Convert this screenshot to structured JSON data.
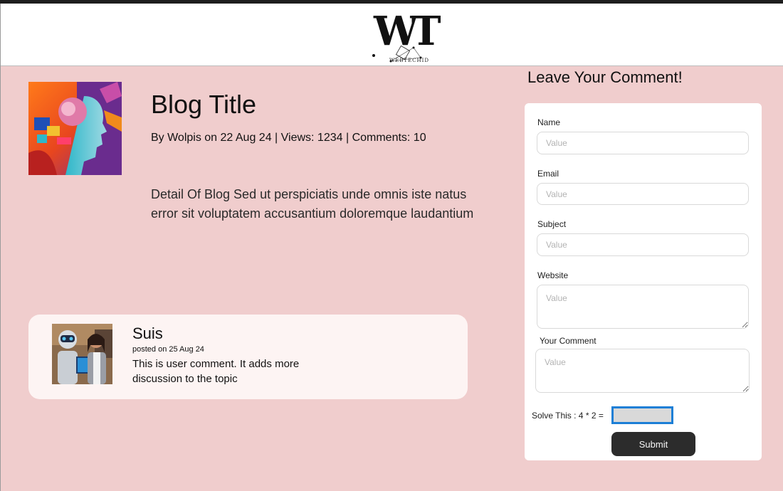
{
  "header": {
    "logo_letters": "WT",
    "logo_subtext": "WEBTECHID"
  },
  "post": {
    "title": "Blog Title",
    "meta": "By Wolpis on 22 Aug 24 | Views: 1234 | Comments: 10",
    "detail": "Detail Of Blog Sed ut perspiciatis unde omnis iste natus error sit voluptatem accusantium doloremque laudantium"
  },
  "comment": {
    "name": "Suis",
    "date": "posted on 25 Aug 24",
    "text": "This is user comment. It adds more discussion to the topic"
  },
  "form": {
    "title": "Leave Your Comment!",
    "name_label": "Name",
    "name_placeholder": "Value",
    "email_label": "Email",
    "email_placeholder": "Value",
    "subject_label": "Subject",
    "subject_placeholder": "Value",
    "website_label": "Website",
    "website_placeholder": "Value",
    "comment_label": "Your Comment",
    "comment_placeholder": "Value",
    "captcha_label": "Solve This : 4 * 2 =",
    "submit_label": "Submit"
  },
  "colors": {
    "page_background": "#f0cdcd",
    "card_background": "#fdf4f3",
    "button": "#2c2c2c",
    "captcha_border": "#1c7fd6"
  }
}
